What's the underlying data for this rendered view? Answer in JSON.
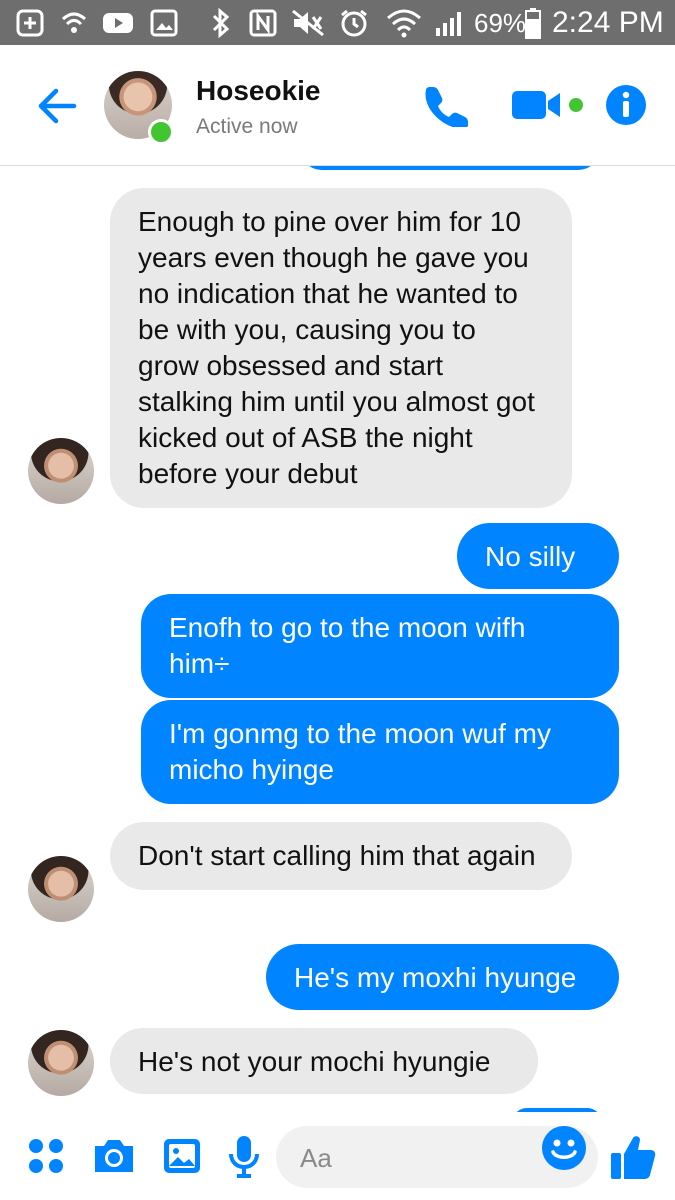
{
  "status_bar": {
    "battery_percent": "69%",
    "time": "2:24 PM",
    "icons": [
      "add-box-icon",
      "wifi-call-icon",
      "youtube-icon",
      "image-icon",
      "bluetooth-icon",
      "nfc-icon",
      "mute-icon",
      "alarm-icon",
      "wifi-icon",
      "signal-icon",
      "battery-icon"
    ]
  },
  "header": {
    "contact_name": "Hoseokie",
    "status": "Active now",
    "icons": [
      "back-arrow-icon",
      "phone-icon",
      "video-camera-icon",
      "info-icon"
    ],
    "accent_color": "#0084ff",
    "online_color": "#42c531"
  },
  "messages": [
    {
      "direction": "in",
      "text": "Enough to pine over him for 10 years even though he gave you no indication that he wanted to be with you, causing you to grow obsessed and start stalking him until you almost got kicked out of ASB the night before your debut"
    },
    {
      "direction": "out",
      "text": "No silly"
    },
    {
      "direction": "out",
      "text": "Enofh to go to the moon wifh him÷"
    },
    {
      "direction": "out",
      "text": "I'm gonmg to the moon wuf my micho hyinge"
    },
    {
      "direction": "in",
      "text": "Don't start calling him that again"
    },
    {
      "direction": "out",
      "text": "He's my moxhi hyunge"
    },
    {
      "direction": "in",
      "text": "He's not your mochi hyungie"
    }
  ],
  "composer": {
    "placeholder": "Aa",
    "icons": [
      "more-dots-icon",
      "camera-icon",
      "gallery-icon",
      "microphone-icon",
      "emoji-icon",
      "thumbs-up-icon"
    ]
  },
  "colors": {
    "outgoing_bubble": "#0084ff",
    "incoming_bubble": "#e9e9e9",
    "status_bar": "#6e6e6e"
  }
}
